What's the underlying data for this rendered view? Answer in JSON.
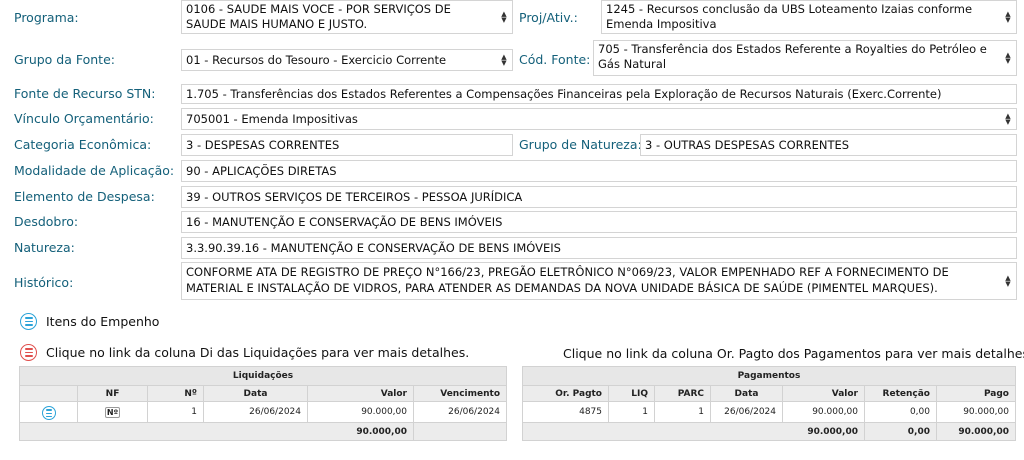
{
  "form": {
    "programa_label": "Programa:",
    "programa_value": "0106 - SAUDE MAIS VOCE - POR SERVIÇOS DE SAUDE MAIS HUMANO E JUSTO.",
    "proj_label": "Proj/Ativ.:",
    "proj_value": "1245 - Recursos conclusão da UBS Loteamento Izaias conforme Emenda Impositiva",
    "grupo_fonte_label": "Grupo da Fonte:",
    "grupo_fonte_value": "01 - Recursos do Tesouro - Exercicio Corrente",
    "cod_fonte_label": "Cód. Fonte:",
    "cod_fonte_value": "705 - Transferência dos Estados Referente a Royalties do Petróleo e Gás Natural",
    "fonte_stn_label": "Fonte de Recurso STN:",
    "fonte_stn_value": "1.705 - Transferências dos Estados Referentes a Compensações Financeiras pela Exploração de Recursos Naturais (Exerc.Corrente)",
    "vinculo_label": "Vínculo Orçamentário:",
    "vinculo_value": "705001 - Emenda Impositivas",
    "categoria_label": "Categoria Econômica:",
    "categoria_value": "3 - DESPESAS CORRENTES",
    "grupo_natureza_label": "Grupo de Natureza:",
    "grupo_natureza_value": "3 - OUTRAS DESPESAS CORRENTES",
    "modalidade_label": "Modalidade de Aplicação:",
    "modalidade_value": "90 - APLICAÇÕES DIRETAS",
    "elemento_label": "Elemento de Despesa:",
    "elemento_value": "39 - OUTROS SERVIÇOS DE TERCEIROS - PESSOA JURÍDICA",
    "desdobro_label": "Desdobro:",
    "desdobro_value": "16 - MANUTENÇÃO E CONSERVAÇÃO DE BENS IMÓVEIS",
    "natureza_label": "Natureza:",
    "natureza_value": "3.3.90.39.16 - MANUTENÇÃO E CONSERVAÇÃO DE BENS IMÓVEIS",
    "historico_label": "Histórico:",
    "historico_value": "CONFORME ATA DE REGISTRO DE PREÇO N°166/23, PREGÃO ELETRÔNICO N°069/23, VALOR EMPENHADO REF A FORNECIMENTO DE MATERIAL E INSTALAÇÃO DE VIDROS, PARA ATENDER AS DEMANDAS DA NOVA UNIDADE BÁSICA DE SAÚDE (PIMENTEL MARQUES)."
  },
  "itens_link": "Itens do Empenho",
  "liquidacoes_hint": "Clique no link da coluna Di das Liquidações para ver mais detalhes.",
  "pagamentos_hint": "Clique no link da coluna Or. Pagto dos Pagamentos para ver mais detalhes.",
  "liquidacoes": {
    "caption": "Liquidações",
    "headers": [
      "NF",
      "Nº",
      "Data",
      "Valor",
      "Vencimento"
    ],
    "row": {
      "nf": "Nº",
      "numero": "1",
      "data": "26/06/2024",
      "valor": "90.000,00",
      "vencimento": "26/06/2024"
    },
    "total": "90.000,00"
  },
  "pagamentos": {
    "caption": "Pagamentos",
    "headers": [
      "Or. Pagto",
      "LIQ",
      "PARC",
      "Data",
      "Valor",
      "Retenção",
      "Pago"
    ],
    "row": {
      "or_pagto": "4875",
      "liq": "1",
      "parc": "1",
      "data": "26/06/2024",
      "valor": "90.000,00",
      "retencao": "0,00",
      "pago": "90.000,00"
    },
    "total_valor": "90.000,00",
    "total_retencao": "0,00",
    "total_pago": "90.000,00"
  }
}
